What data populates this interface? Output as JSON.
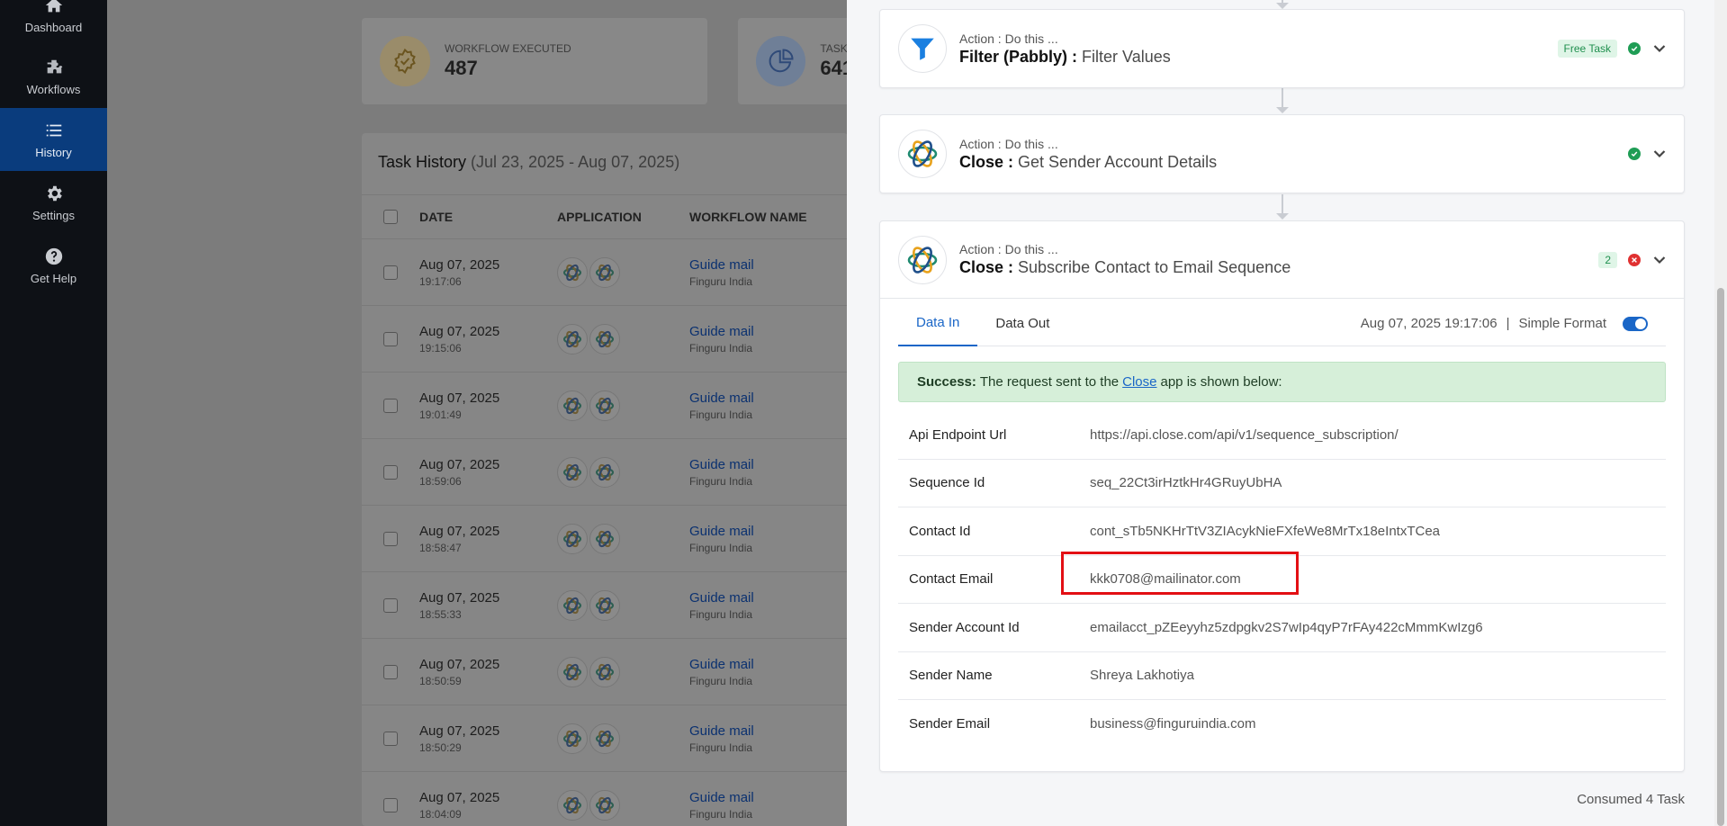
{
  "sidebar": {
    "items": [
      {
        "label": "Dashboard",
        "icon": "home-icon"
      },
      {
        "label": "Workflows",
        "icon": "workflows-icon"
      },
      {
        "label": "History",
        "icon": "history-icon",
        "active": true
      },
      {
        "label": "Settings",
        "icon": "gear-icon"
      },
      {
        "label": "Get Help",
        "icon": "help-icon"
      }
    ]
  },
  "stats": [
    {
      "label": "WORKFLOW EXECUTED",
      "value": "487"
    },
    {
      "label": "TASK C",
      "value": "641"
    }
  ],
  "history": {
    "title": "Task History",
    "range": "(Jul 23, 2025 - Aug 07, 2025)",
    "columns": {
      "date": "DATE",
      "application": "APPLICATION",
      "workflow": "WORKFLOW NAME"
    },
    "rows": [
      {
        "date": "Aug 07, 2025",
        "time": "19:17:06",
        "workflow": "Guide mail",
        "owner": "Finguru India"
      },
      {
        "date": "Aug 07, 2025",
        "time": "19:15:06",
        "workflow": "Guide mail",
        "owner": "Finguru India"
      },
      {
        "date": "Aug 07, 2025",
        "time": "19:01:49",
        "workflow": "Guide mail",
        "owner": "Finguru India"
      },
      {
        "date": "Aug 07, 2025",
        "time": "18:59:06",
        "workflow": "Guide mail",
        "owner": "Finguru India"
      },
      {
        "date": "Aug 07, 2025",
        "time": "18:58:47",
        "workflow": "Guide mail",
        "owner": "Finguru India"
      },
      {
        "date": "Aug 07, 2025",
        "time": "18:55:33",
        "workflow": "Guide mail",
        "owner": "Finguru India"
      },
      {
        "date": "Aug 07, 2025",
        "time": "18:50:59",
        "workflow": "Guide mail",
        "owner": "Finguru India"
      },
      {
        "date": "Aug 07, 2025",
        "time": "18:50:29",
        "workflow": "Guide mail",
        "owner": "Finguru India"
      },
      {
        "date": "Aug 07, 2025",
        "time": "18:04:09",
        "workflow": "Guide mail",
        "owner": "Finguru India"
      }
    ]
  },
  "steps": [
    {
      "kicker": "Action : Do this ...",
      "app": "Filter (Pabbly) :",
      "action": "Filter Values",
      "badge": "Free Task",
      "status": "success"
    },
    {
      "kicker": "Action : Do this ...",
      "app": "Close :",
      "action": "Get Sender Account Details",
      "status": "success"
    },
    {
      "kicker": "Action : Do this ...",
      "app": "Close :",
      "action": "Subscribe Contact to Email Sequence",
      "badge": "2",
      "status": "error"
    }
  ],
  "detail": {
    "tabs": [
      "Data In",
      "Data Out"
    ],
    "timestamp": "Aug 07, 2025 19:17:06",
    "separator": "|",
    "format_label": "Simple Format",
    "success": {
      "strong": "Success:",
      "before": "The request sent to the",
      "link": "Close",
      "after": "app is shown below:"
    },
    "fields": [
      {
        "key": "Api Endpoint Url",
        "value": "https://api.close.com/api/v1/sequence_subscription/"
      },
      {
        "key": "Sequence Id",
        "value": "seq_22Ct3irHztkHr4GRuyUbHA"
      },
      {
        "key": "Contact Id",
        "value": "cont_sTb5NKHrTtV3ZIAcykNieFXfeWe8MrTx18eIntxTCea"
      },
      {
        "key": "Contact Email",
        "value": "kkk0708@mailinator.com"
      },
      {
        "key": "Sender Account Id",
        "value": "emailacct_pZEeyyhz5zdpgkv2S7wIp4qyP7rFAy422cMmmKwIzg6"
      },
      {
        "key": "Sender Name",
        "value": "Shreya Lakhotiya"
      },
      {
        "key": "Sender Email",
        "value": "business@finguruindia.com"
      }
    ]
  },
  "footer": {
    "consumed": "Consumed 4 Task"
  },
  "colors": {
    "accent": "#1a66c7",
    "success": "#1f9d55",
    "error": "#e03131",
    "highlight": "#e30f14",
    "sidebar_active": "#0a3c7d"
  }
}
